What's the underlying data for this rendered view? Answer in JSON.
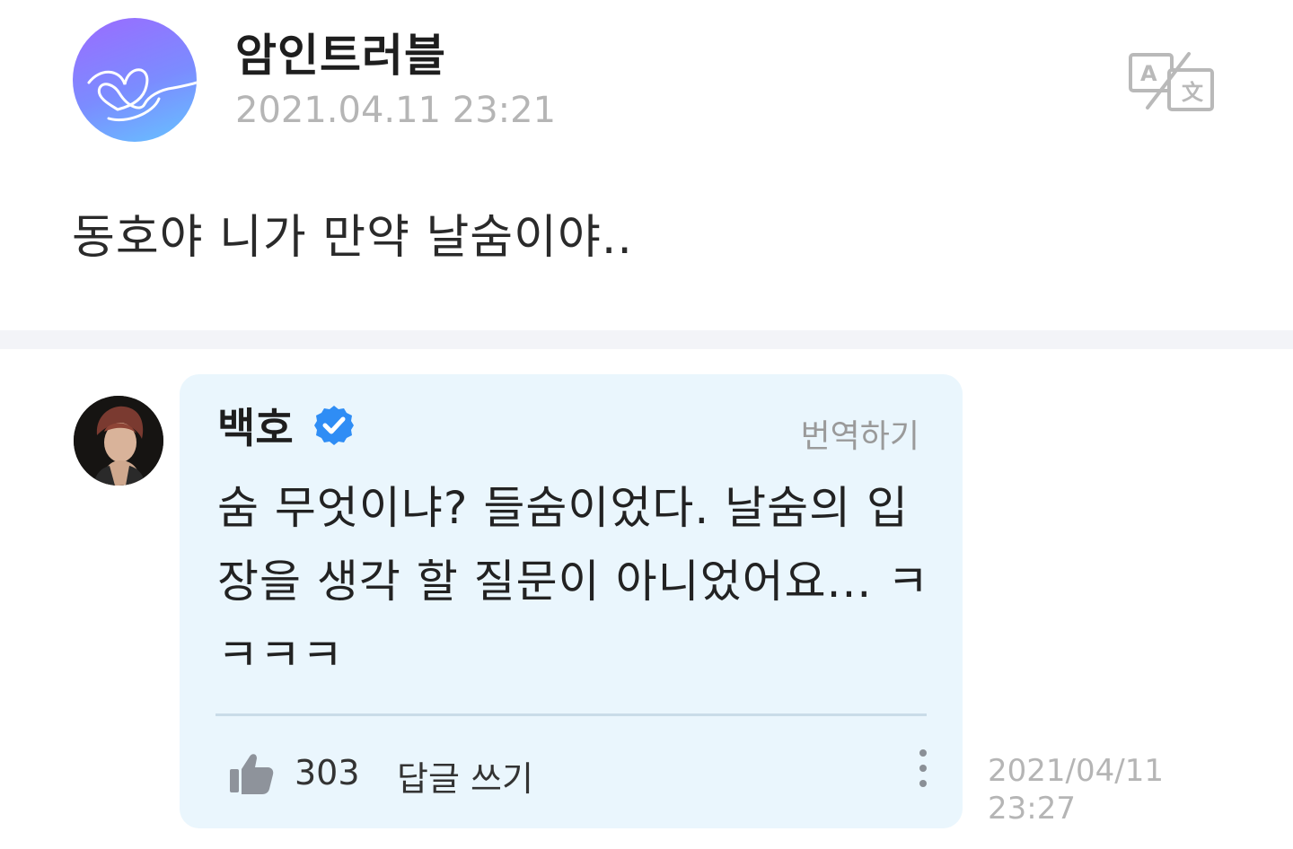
{
  "post": {
    "author": "암인트러블",
    "date": "2021.04.11 23:21",
    "body": "동호야 니가 만약 날숨이야..",
    "translate_icon": "translate-icon"
  },
  "comment": {
    "author": "백호",
    "verified_icon": "verified-badge-icon",
    "translate_label": "번역하기",
    "text": "숨 무엇이냐? 들숨이었다. 날숨의 입장을 생각 할 질문이 아니었어요... ㅋㅋㅋㅋ",
    "like_icon": "thumbs-up-icon",
    "like_count": "303",
    "reply_label": "답글 쓰기",
    "more_icon": "more-vertical-icon",
    "date_line1": "2021/04/11",
    "date_line2": "23:27"
  },
  "colors": {
    "bubble": "#eaf6fd",
    "verified": "#2f8df5",
    "muted": "#b5b5b5",
    "avatar_gradient_start": "#9b6bff",
    "avatar_gradient_end": "#66c3ff"
  }
}
